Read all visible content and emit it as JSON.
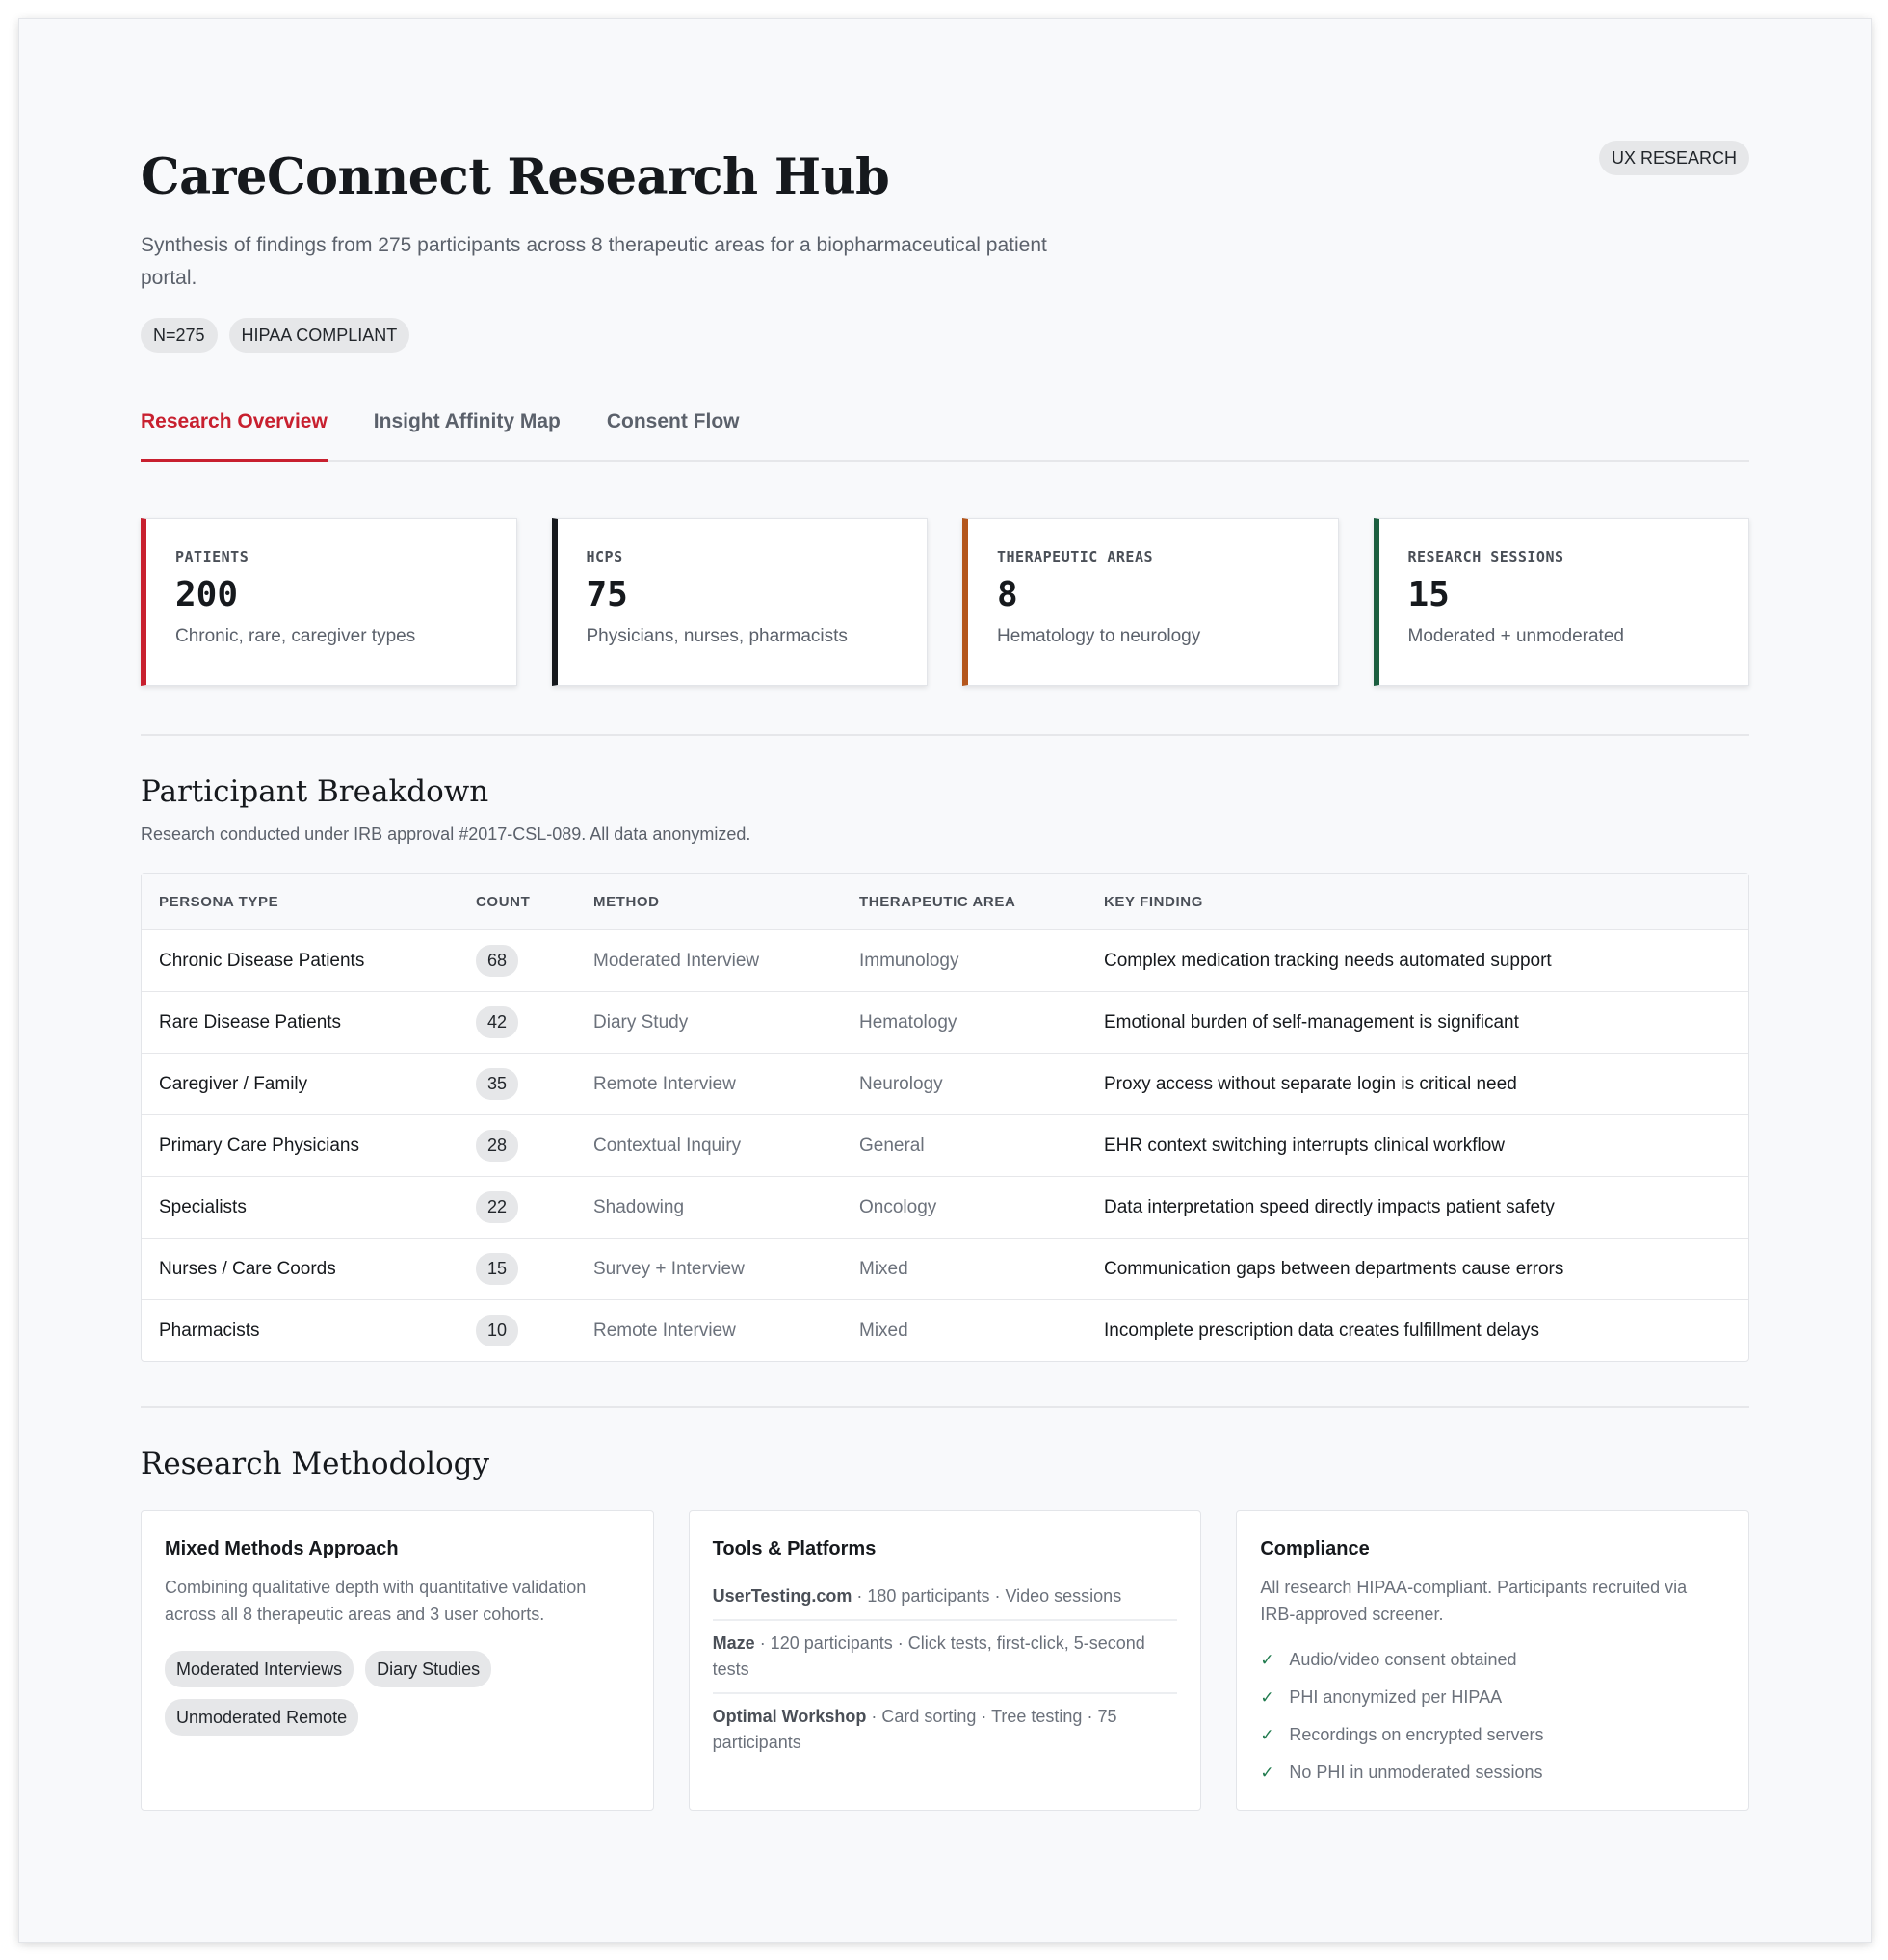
{
  "header": {
    "title": "CareConnect Research Hub",
    "subtitle": "Synthesis of findings from 275 participants across 8 therapeutic areas for a biopharmaceutical patient portal.",
    "badge": "UX RESEARCH",
    "tags": [
      "N=275",
      "HIPAA COMPLIANT"
    ]
  },
  "tabs": [
    {
      "label": "Research Overview",
      "active": true
    },
    {
      "label": "Insight Affinity Map",
      "active": false
    },
    {
      "label": "Consent Flow",
      "active": false
    }
  ],
  "stats": [
    {
      "label": "PATIENTS",
      "value": "200",
      "desc": "Chronic, rare, caregiver types",
      "color": "#c8202f"
    },
    {
      "label": "HCPS",
      "value": "75",
      "desc": "Physicians, nurses, pharmacists",
      "color": "#16191d"
    },
    {
      "label": "THERAPEUTIC AREAS",
      "value": "8",
      "desc": "Hematology to neurology",
      "color": "#b4561c"
    },
    {
      "label": "RESEARCH SESSIONS",
      "value": "15",
      "desc": "Moderated + unmoderated",
      "color": "#1b5e3f"
    }
  ],
  "breakdown": {
    "title": "Participant Breakdown",
    "note": "Research conducted under IRB approval #2017-CSL-089. All data anonymized.",
    "columns": [
      "PERSONA TYPE",
      "COUNT",
      "METHOD",
      "THERAPEUTIC AREA",
      "KEY FINDING"
    ],
    "rows": [
      {
        "persona": "Chronic Disease Patients",
        "count": "68",
        "method": "Moderated Interview",
        "area": "Immunology",
        "finding": "Complex medication tracking needs automated support"
      },
      {
        "persona": "Rare Disease Patients",
        "count": "42",
        "method": "Diary Study",
        "area": "Hematology",
        "finding": "Emotional burden of self-management is significant"
      },
      {
        "persona": "Caregiver / Family",
        "count": "35",
        "method": "Remote Interview",
        "area": "Neurology",
        "finding": "Proxy access without separate login is critical need"
      },
      {
        "persona": "Primary Care Physicians",
        "count": "28",
        "method": "Contextual Inquiry",
        "area": "General",
        "finding": "EHR context switching interrupts clinical workflow"
      },
      {
        "persona": "Specialists",
        "count": "22",
        "method": "Shadowing",
        "area": "Oncology",
        "finding": "Data interpretation speed directly impacts patient safety"
      },
      {
        "persona": "Nurses / Care Coords",
        "count": "15",
        "method": "Survey + Interview",
        "area": "Mixed",
        "finding": "Communication gaps between departments cause errors"
      },
      {
        "persona": "Pharmacists",
        "count": "10",
        "method": "Remote Interview",
        "area": "Mixed",
        "finding": "Incomplete prescription data creates fulfillment delays"
      }
    ]
  },
  "methodology": {
    "title": "Research Methodology",
    "mixed": {
      "title": "Mixed Methods Approach",
      "text": "Combining qualitative depth with quantitative validation across all 8 therapeutic areas and 3 user cohorts.",
      "chips": [
        "Moderated Interviews",
        "Diary Studies",
        "Unmoderated Remote"
      ]
    },
    "tools": {
      "title": "Tools & Platforms",
      "items": [
        {
          "name": "UserTesting.com",
          "detail": " · 180 participants · Video sessions"
        },
        {
          "name": "Maze",
          "detail": " · 120 participants · Click tests, first-click, 5-second tests"
        },
        {
          "name": "Optimal Workshop",
          "detail": " · Card sorting · Tree testing · 75 participants"
        }
      ]
    },
    "compliance": {
      "title": "Compliance",
      "text": "All research HIPAA-compliant. Participants recruited via IRB-approved screener.",
      "checks": [
        "Audio/video consent obtained",
        "PHI anonymized per HIPAA",
        "Recordings on encrypted servers",
        "No PHI in unmoderated sessions"
      ]
    }
  }
}
